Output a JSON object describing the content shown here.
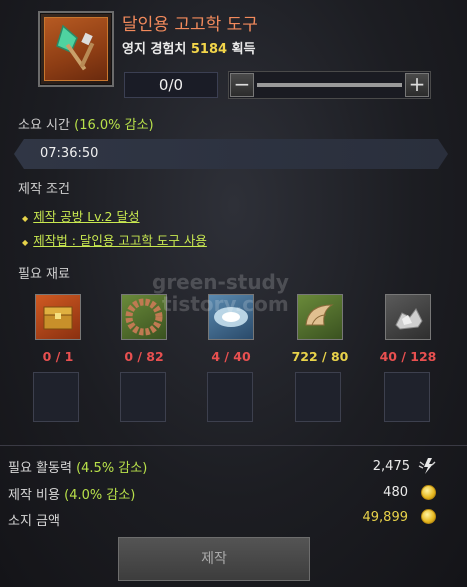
{
  "header": {
    "title": "달인용 고고학 도구",
    "exp_label": "영지 경험치",
    "exp_value": "5184",
    "exp_suffix": "획득",
    "icon": "shovel-brush-icon"
  },
  "quantity": {
    "value": "0/0",
    "minus": "−",
    "plus": "+"
  },
  "time": {
    "label": "소요 시간",
    "reduction": "(16.0% 감소)",
    "value": "07:36:50"
  },
  "conditions": {
    "label": "제작 조건",
    "items": [
      "제작 공방 Lv.2 달성",
      "제작법 : 달인용 고고학 도구 사용"
    ]
  },
  "materials": {
    "label": "필요 재료",
    "items": [
      {
        "icon": "treasure-chest-icon",
        "count": "0 / 1",
        "status": "insufficient",
        "color": "#b8451e"
      },
      {
        "icon": "gear-ring-icon",
        "count": "0 / 82",
        "status": "insufficient",
        "color": "#4f6a2c"
      },
      {
        "icon": "crystal-shard-icon",
        "count": "4 / 40",
        "status": "insufficient",
        "color": "#3a6a8a"
      },
      {
        "icon": "claw-fossil-icon",
        "count": "722 / 80",
        "status": "sufficient",
        "color": "#4f6a2c"
      },
      {
        "icon": "ore-pile-icon",
        "count": "40 / 128",
        "status": "insufficient",
        "color": "#4a4a4a"
      }
    ]
  },
  "costs": {
    "energy_label": "필요 활동력",
    "energy_reduction": "(4.5% 감소)",
    "energy_value": "2,475",
    "energy_icon": "lightning-wing-icon",
    "gold_label": "제작 비용",
    "gold_reduction": "(4.0% 감소)",
    "gold_value": "480",
    "owned_label": "소지 금액",
    "owned_value": "49,899",
    "coin_icon": "gold-coin-icon"
  },
  "watermark": {
    "line1": "green-study",
    "line2": "tistory.com"
  },
  "craft_button": "제작",
  "colors": {
    "title": "#f28a5c",
    "reduction": "#b8e04a",
    "condition": "#c8e850",
    "insufficient": "#e85050",
    "sufficient": "#e8d24a"
  }
}
